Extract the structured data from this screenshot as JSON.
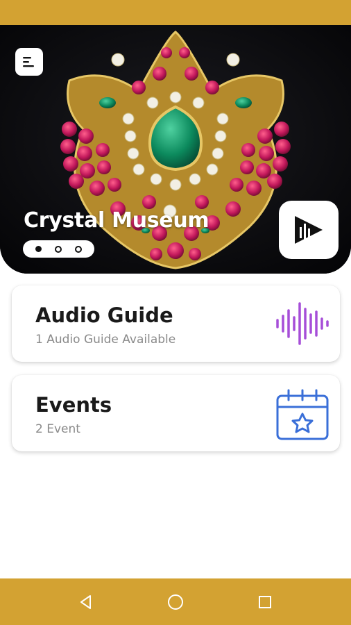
{
  "status_bar": {
    "color": "#d3a232"
  },
  "hero": {
    "title": "Crystal Museum",
    "pager": {
      "count": 3,
      "active_index": 0
    },
    "menu_icon": "menu-icon",
    "play_icon": "play-audio-icon"
  },
  "cards": [
    {
      "title": "Audio Guide",
      "subtitle": "1 Audio Guide Available",
      "icon": "audio-wave-icon",
      "icon_color": "#a64ed8"
    },
    {
      "title": "Events",
      "subtitle": "2 Event",
      "icon": "calendar-star-icon",
      "icon_color": "#3a6fd8"
    }
  ],
  "nav_bar": {
    "color": "#d3a232",
    "buttons": [
      "back-icon",
      "home-icon",
      "recents-icon"
    ]
  }
}
